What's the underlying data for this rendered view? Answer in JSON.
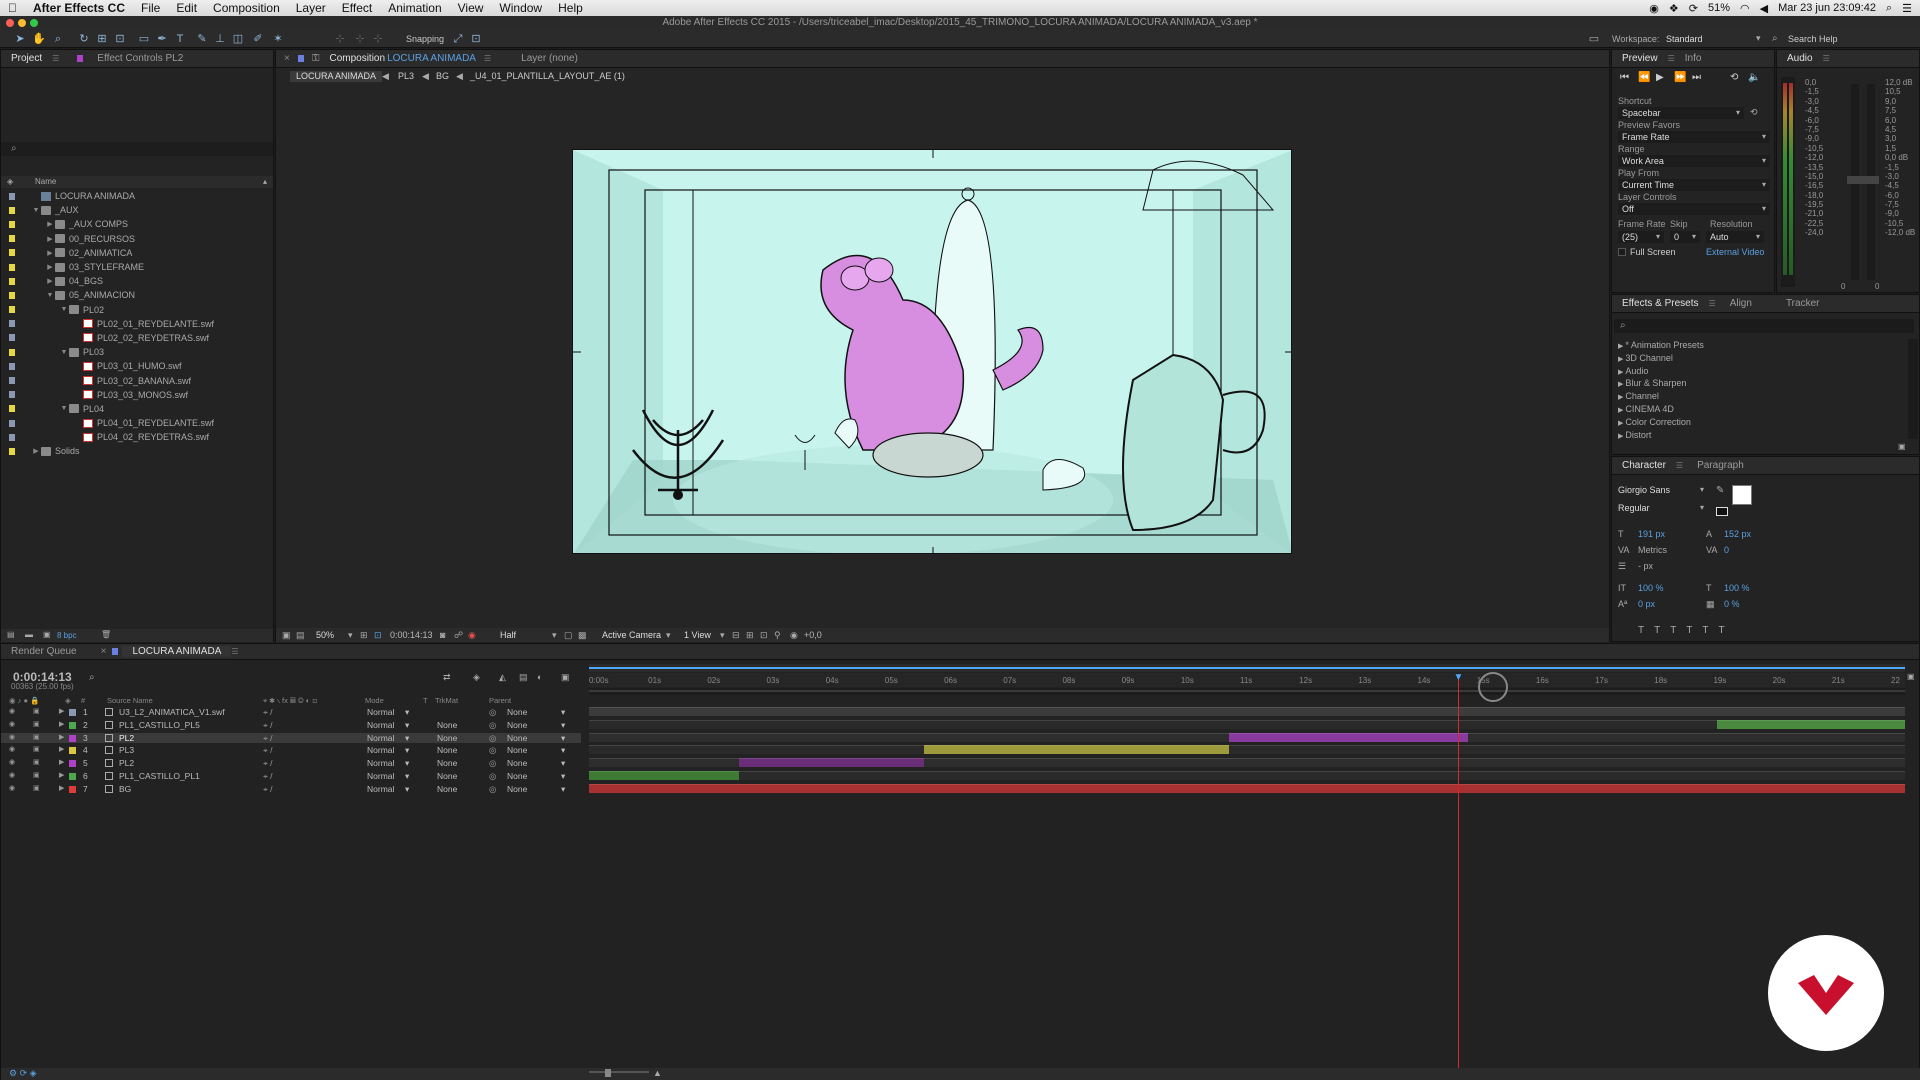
{
  "menubar": {
    "apple": "",
    "app_name": "After Effects CC",
    "items": [
      "File",
      "Edit",
      "Composition",
      "Layer",
      "Effect",
      "Animation",
      "View",
      "Window",
      "Help"
    ],
    "battery": "51%",
    "datetime": "Mar 23 jun  23:09:42"
  },
  "window": {
    "title": "Adobe After Effects CC 2015 - /Users/triceabel_imac/Desktop/2015_45_TRIMONO_LOCURA ANIMADA/LOCURA ANIMADA_v3.aep *"
  },
  "toolbar": {
    "snapping_label": "Snapping",
    "workspace_label": "Workspace:",
    "workspace_value": "Standard",
    "search_help": "Search Help"
  },
  "project_panel": {
    "tabs": [
      "Project",
      "Effect Controls PL2"
    ],
    "column_name": "Name",
    "items": [
      {
        "label": "LOCURA ANIMADA",
        "depth": 0,
        "kind": "comp",
        "tri": "",
        "swatch": "#8a98b4"
      },
      {
        "label": "_AUX",
        "depth": 0,
        "kind": "folder",
        "tri": "▼",
        "swatch": "#e8d840"
      },
      {
        "label": "_AUX COMPS",
        "depth": 1,
        "kind": "folder",
        "tri": "▶",
        "swatch": "#e8d840"
      },
      {
        "label": "00_RECURSOS",
        "depth": 1,
        "kind": "folder",
        "tri": "▶",
        "swatch": "#e8d840"
      },
      {
        "label": "02_ANIMATICA",
        "depth": 1,
        "kind": "folder",
        "tri": "▶",
        "swatch": "#e8d840"
      },
      {
        "label": "03_STYLEFRAME",
        "depth": 1,
        "kind": "folder",
        "tri": "▶",
        "swatch": "#e8d840"
      },
      {
        "label": "04_BGS",
        "depth": 1,
        "kind": "folder",
        "tri": "▶",
        "swatch": "#e8d840"
      },
      {
        "label": "05_ANIMACION",
        "depth": 1,
        "kind": "folder",
        "tri": "▼",
        "swatch": "#e8d840"
      },
      {
        "label": "PL02",
        "depth": 2,
        "kind": "folder",
        "tri": "▼",
        "swatch": "#e8d840"
      },
      {
        "label": "PL02_01_REYDELANTE.swf",
        "depth": 3,
        "kind": "swf",
        "tri": "",
        "swatch": "#8a98b4"
      },
      {
        "label": "PL02_02_REYDETRAS.swf",
        "depth": 3,
        "kind": "swf",
        "tri": "",
        "swatch": "#8a98b4"
      },
      {
        "label": "PL03",
        "depth": 2,
        "kind": "folder",
        "tri": "▼",
        "swatch": "#e8d840"
      },
      {
        "label": "PL03_01_HUMO.swf",
        "depth": 3,
        "kind": "swf",
        "tri": "",
        "swatch": "#8a98b4"
      },
      {
        "label": "PL03_02_BANANA.swf",
        "depth": 3,
        "kind": "swf",
        "tri": "",
        "swatch": "#8a98b4"
      },
      {
        "label": "PL03_03_MONOS.swf",
        "depth": 3,
        "kind": "swf",
        "tri": "",
        "swatch": "#8a98b4"
      },
      {
        "label": "PL04",
        "depth": 2,
        "kind": "folder",
        "tri": "▼",
        "swatch": "#e8d840"
      },
      {
        "label": "PL04_01_REYDELANTE.swf",
        "depth": 3,
        "kind": "swf",
        "tri": "",
        "swatch": "#8a98b4"
      },
      {
        "label": "PL04_02_REYDETRAS.swf",
        "depth": 3,
        "kind": "swf",
        "tri": "",
        "swatch": "#8a98b4"
      },
      {
        "label": "Solids",
        "depth": 0,
        "kind": "folder",
        "tri": "▶",
        "swatch": "#e8d840"
      }
    ],
    "bpc": "8 bpc"
  },
  "composition_panel": {
    "tab_label": "Composition",
    "comp_name": "LOCURA ANIMADA",
    "layer_tab": "Layer (none)",
    "breadcrumbs": [
      "LOCURA ANIMADA",
      "PL3",
      "BG",
      "_U4_01_PLANTILLA_LAYOUT_AE (1)"
    ],
    "zoom": "50%",
    "timecode": "0:00:14:13",
    "resolution": "Half",
    "camera": "Active Camera",
    "views": "1 View",
    "exposure": "+0,0"
  },
  "preview_panel": {
    "tabs": [
      "Preview",
      "Info"
    ],
    "shortcut_label": "Shortcut",
    "shortcut_value": "Spacebar",
    "favors_label": "Preview Favors",
    "favors_value": "Frame Rate",
    "range_label": "Range",
    "range_value": "Work Area",
    "playfrom_label": "Play From",
    "playfrom_value": "Current Time",
    "layerctrl_label": "Layer Controls",
    "layerctrl_value": "Off",
    "framerate_label": "Frame Rate",
    "skip_label": "Skip",
    "resolution_label": "Resolution",
    "framerate_value": "(25)",
    "skip_value": "0",
    "resolution_value": "Auto",
    "fullscreen_label": "Full Screen",
    "external_video": "External Video"
  },
  "audio_panel": {
    "title": "Audio",
    "left_scale": [
      "0,0",
      "-1,5",
      "-3,0",
      "-4,5",
      "-6,0",
      "-7,5",
      "-9,0",
      "-10,5",
      "-12,0",
      "-13,5",
      "-15,0",
      "-16,5",
      "-18,0",
      "-19,5",
      "-21,0",
      "-22,5",
      "-24,0"
    ],
    "right_scale": [
      "12,0 dB",
      "10,5",
      "9,0",
      "7,5",
      "6,0",
      "4,5",
      "3,0",
      "1,5",
      "0,0 dB",
      "-1,5",
      "-3,0",
      "-4,5",
      "-6,0",
      "-7,5",
      "-9,0",
      "-10,5",
      "-12,0 dB"
    ],
    "bottom": [
      "0",
      "0"
    ]
  },
  "effects_panel": {
    "tabs": [
      "Effects & Presets",
      "Align",
      "Tracker"
    ],
    "items": [
      "* Animation Presets",
      "3D Channel",
      "Audio",
      "Blur & Sharpen",
      "Channel",
      "CINEMA 4D",
      "Color Correction",
      "Distort"
    ]
  },
  "character_panel": {
    "tabs": [
      "Character",
      "Paragraph"
    ],
    "font": "Giorgio Sans",
    "style": "Regular",
    "size": "191 px",
    "leading": "152 px",
    "kerning": "Metrics",
    "tracking": "0",
    "stroke": "- px",
    "vscale": "100 %",
    "hscale": "100 %",
    "baseline": "0 px",
    "tsume": "0 %",
    "fill_color": "#ffffff",
    "stroke_color": "#111111"
  },
  "timeline": {
    "tabs": [
      "Render Queue",
      "LOCURA ANIMADA"
    ],
    "timecode": "0:00:14:13",
    "frame_info": "00363 (25.00 fps)",
    "columns": {
      "source": "Source Name",
      "mode": "Mode",
      "t": "T",
      "trkmat": "TrkMat",
      "parent": "Parent"
    },
    "ruler": [
      "0:00s",
      "01s",
      "02s",
      "03s",
      "04s",
      "05s",
      "06s",
      "07s",
      "08s",
      "09s",
      "10s",
      "11s",
      "12s",
      "13s",
      "14s",
      "15s",
      "16s",
      "17s",
      "18s",
      "19s",
      "20s",
      "21s",
      "22"
    ],
    "duration_seconds": 22,
    "current_time_seconds": 14.52,
    "layers": [
      {
        "num": "1",
        "name": "U3_L2_ANIMATICA_V1.swf",
        "mode": "Normal",
        "trkmat": "",
        "parent": "None",
        "label_color": "#8a98b4",
        "bar_color": "#3b3b3b",
        "start": 0,
        "end": 22,
        "selected": false
      },
      {
        "num": "2",
        "name": "PL1_CASTILLO_PL5",
        "mode": "Normal",
        "trkmat": "None",
        "parent": "None",
        "label_color": "#4ea84e",
        "bar_color": "#4a8a3f",
        "start": 18.85,
        "end": 22,
        "selected": false
      },
      {
        "num": "3",
        "name": "PL2",
        "mode": "Normal",
        "trkmat": "None",
        "parent": "None",
        "label_color": "#b040c8",
        "bar_color": "#8a3a9c",
        "start": 10.7,
        "end": 14.7,
        "selected": true
      },
      {
        "num": "4",
        "name": "PL3",
        "mode": "Normal",
        "trkmat": "None",
        "parent": "None",
        "label_color": "#d8c840",
        "bar_color": "#9c9a3a",
        "start": 5.6,
        "end": 10.7,
        "selected": false
      },
      {
        "num": "5",
        "name": "PL2",
        "mode": "Normal",
        "trkmat": "None",
        "parent": "None",
        "label_color": "#b040c8",
        "bar_color": "#6a2d78",
        "start": 2.5,
        "end": 5.6,
        "selected": false
      },
      {
        "num": "6",
        "name": "PL1_CASTILLO_PL1",
        "mode": "Normal",
        "trkmat": "None",
        "parent": "None",
        "label_color": "#4ea84e",
        "bar_color": "#3f7a35",
        "start": 0,
        "end": 2.5,
        "selected": false
      },
      {
        "num": "7",
        "name": "BG",
        "mode": "Normal",
        "trkmat": "None",
        "parent": "None",
        "label_color": "#e03a3a",
        "bar_color": "#a83030",
        "start": 0,
        "end": 22,
        "selected": false
      }
    ]
  },
  "colors": {
    "accent_blue": "#4aa8ff",
    "playhead": "#d62a2a",
    "canvas_bg": "#c8f4ee",
    "logo_red": "#c8102e"
  }
}
